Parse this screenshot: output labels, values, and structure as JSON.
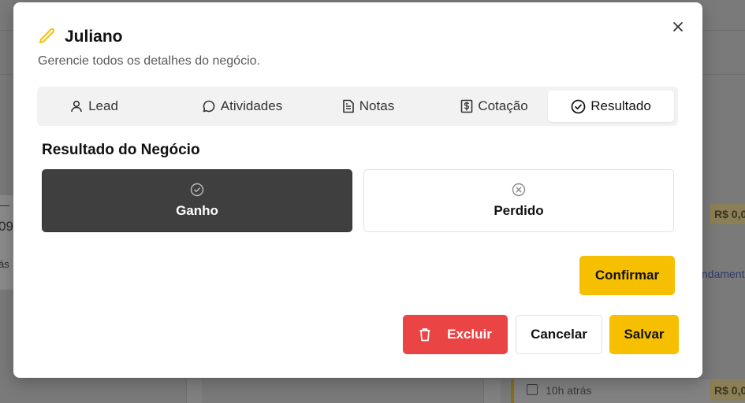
{
  "background": {
    "left_snippets": [
      "—",
      "09",
      "ás"
    ],
    "badges": [
      "R$ 0,0",
      "R$ 0,0"
    ],
    "tag": "ndamento",
    "footer_time": "10h atrás"
  },
  "modal": {
    "title": "Juliano",
    "subtitle": "Gerencie todos os detalhes do negócio.",
    "tabs": [
      {
        "label": "Lead",
        "icon": "user-icon"
      },
      {
        "label": "Atividades",
        "icon": "chat-bubble-icon"
      },
      {
        "label": "Notas",
        "icon": "document-icon"
      },
      {
        "label": "Cotação",
        "icon": "dollar-document-icon"
      },
      {
        "label": "Resultado",
        "icon": "check-circle-icon",
        "active": true
      }
    ],
    "section_title": "Resultado do Negócio",
    "outcomes": {
      "won": {
        "label": "Ganho",
        "selected": true
      },
      "lost": {
        "label": "Perdido",
        "selected": false
      }
    },
    "confirm_label": "Confirmar",
    "delete_label": "Excluir",
    "cancel_label": "Cancelar",
    "save_label": "Salvar"
  },
  "colors": {
    "accent": "#f6c000",
    "danger": "#ea4444",
    "selected": "#3f3f3f"
  }
}
